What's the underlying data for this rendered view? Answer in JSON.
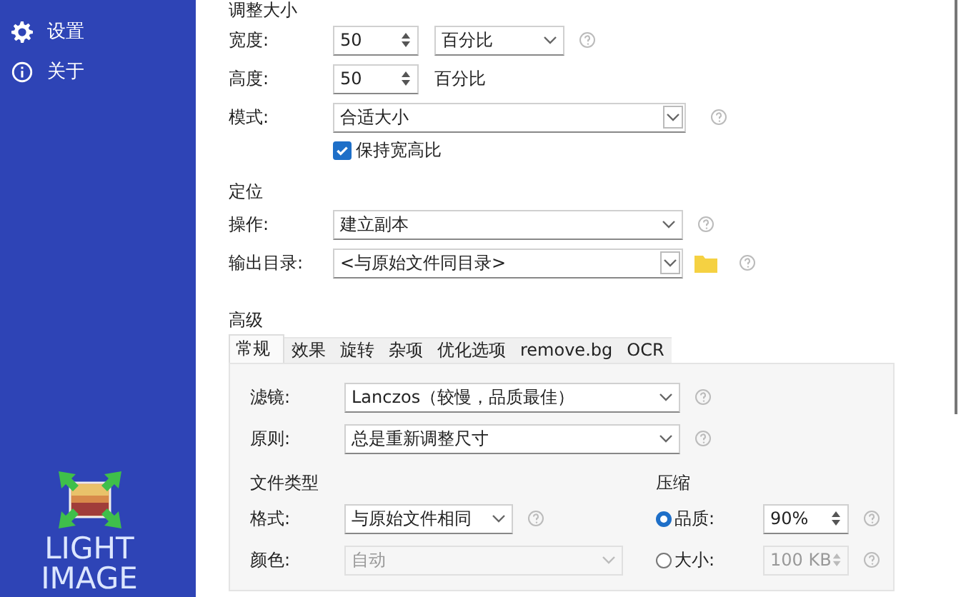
{
  "sidebar": {
    "items": [
      {
        "kind": "gear",
        "label": "设置"
      },
      {
        "kind": "info",
        "label": "关于"
      }
    ],
    "logo": {
      "line1": "LIGHT",
      "line2": "IMAGE"
    }
  },
  "resize": {
    "title": "调整大小",
    "width": {
      "label": "宽度:",
      "value": "50",
      "unit": "百分比"
    },
    "height": {
      "label": "高度:",
      "value": "50",
      "unit": "百分比"
    },
    "mode": {
      "label": "模式:",
      "value": "合适大小"
    },
    "keep_ratio": {
      "label": "保持宽高比",
      "checked": true
    }
  },
  "target": {
    "title": "定位",
    "operation": {
      "label": "操作:",
      "value": "建立副本"
    },
    "output_dir": {
      "label": "输出目录:",
      "value": "<与原始文件同目录>"
    }
  },
  "advanced": {
    "title": "高级",
    "tabs": [
      {
        "label": "常规",
        "selected": true
      },
      {
        "label": "效果",
        "selected": false
      },
      {
        "label": "旋转",
        "selected": false
      },
      {
        "label": "杂项",
        "selected": false
      },
      {
        "label": "优化选项",
        "selected": false
      },
      {
        "label": "remove.bg",
        "selected": false
      },
      {
        "label": "OCR",
        "selected": false
      }
    ],
    "filter": {
      "label": "滤镜:",
      "value": "Lanczos（较慢，品质最佳）"
    },
    "rule": {
      "label": "原则:",
      "value": "总是重新调整尺寸"
    },
    "file_type": {
      "title": "文件类型",
      "format": {
        "label": "格式:",
        "value": "与原始文件相同"
      },
      "color": {
        "label": "颜色:",
        "value": "自动",
        "disabled": true
      }
    },
    "compression": {
      "title": "压缩",
      "options": [
        {
          "label": "品质:",
          "value": "90%",
          "selected": true
        },
        {
          "label": "大小:",
          "value": "100 KB",
          "selected": false
        }
      ]
    }
  }
}
